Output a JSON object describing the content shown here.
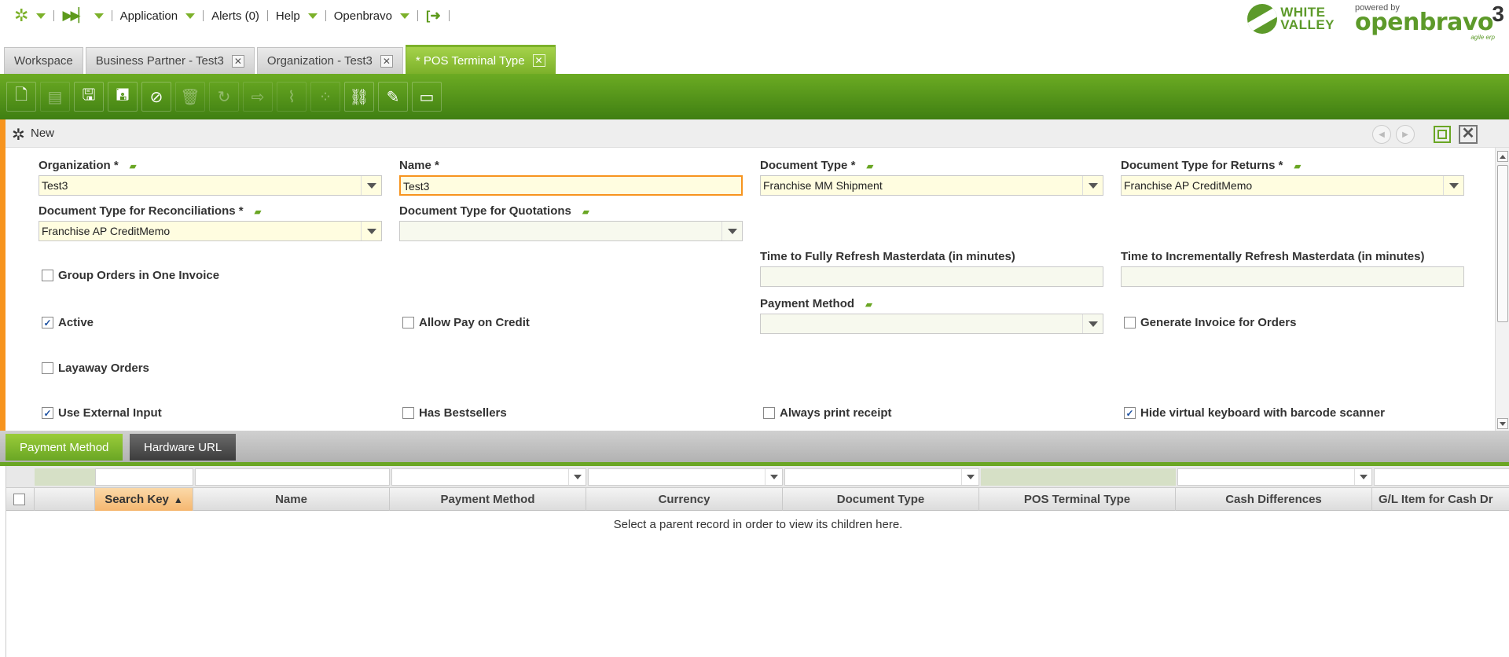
{
  "menu": {
    "application_label": "Application",
    "alerts_label": "Alerts (0)",
    "help_label": "Help",
    "user_label": "Openbravo"
  },
  "logos": {
    "wv_line1": "WHITE",
    "wv_line2": "VALLEY",
    "powered_by": "powered by",
    "ob_name": "openbravo",
    "ob_version": "3",
    "ob_tagline": "agile erp"
  },
  "tabs": [
    {
      "label": "Workspace",
      "closable": false
    },
    {
      "label": "Business Partner - Test3",
      "closable": true
    },
    {
      "label": "Organization - Test3",
      "closable": true
    },
    {
      "label": "* POS Terminal Type",
      "closable": true,
      "active": true
    }
  ],
  "form": {
    "status": "New",
    "organization": {
      "label": "Organization",
      "value": "Test3"
    },
    "name": {
      "label": "Name",
      "value": "Test3"
    },
    "document_type": {
      "label": "Document Type",
      "value": "Franchise MM Shipment"
    },
    "document_type_returns": {
      "label": "Document Type for Returns",
      "value": "Franchise AP CreditMemo"
    },
    "document_type_reconciliations": {
      "label": "Document Type for Reconciliations",
      "value": "Franchise AP CreditMemo"
    },
    "document_type_quotations": {
      "label": "Document Type for Quotations",
      "value": ""
    },
    "time_full_refresh": {
      "label": "Time to Fully Refresh Masterdata (in minutes)",
      "value": ""
    },
    "time_incremental_refresh": {
      "label": "Time to Incrementally Refresh Masterdata (in minutes)",
      "value": ""
    },
    "payment_method": {
      "label": "Payment Method",
      "value": ""
    },
    "group_orders": {
      "label": "Group Orders in One Invoice",
      "checked": false
    },
    "active": {
      "label": "Active",
      "checked": true
    },
    "allow_pay_credit": {
      "label": "Allow Pay on Credit",
      "checked": false
    },
    "generate_invoice": {
      "label": "Generate Invoice for Orders",
      "checked": false
    },
    "layaway_orders": {
      "label": "Layaway Orders",
      "checked": false
    },
    "use_external_input": {
      "label": "Use External Input",
      "checked": true
    },
    "has_bestsellers": {
      "label": "Has Bestsellers",
      "checked": false
    },
    "always_print_receipt": {
      "label": "Always print receipt",
      "checked": false
    },
    "hide_virtual_keyboard": {
      "label": "Hide virtual keyboard with barcode scanner",
      "checked": true
    },
    "required_mark": "*"
  },
  "subtabs": [
    {
      "label": "Payment Method",
      "active": true
    },
    {
      "label": "Hardware URL",
      "active": false
    }
  ],
  "grid": {
    "columns": [
      "Search Key",
      "Name",
      "Payment Method",
      "Currency",
      "Document Type",
      "POS Terminal Type",
      "Cash Differences",
      "G/L Item for Cash Dr"
    ],
    "sorted_column": "Search Key",
    "empty_message": "Select a parent record in order to view its children here."
  },
  "colors": {
    "brand_green": "#6aa624",
    "accent_orange": "#f7941e",
    "required_field_bg": "#fffde0"
  }
}
